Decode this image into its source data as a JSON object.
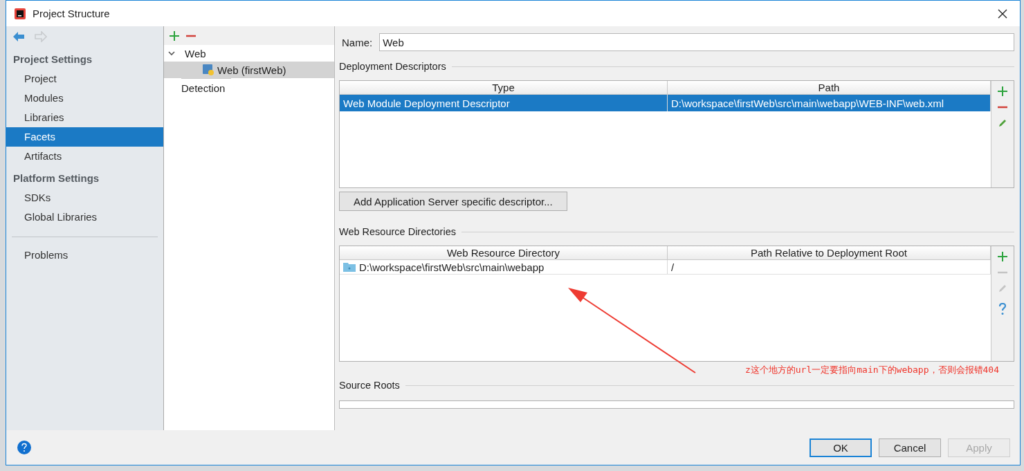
{
  "window": {
    "title": "Project Structure"
  },
  "sidebar": {
    "groups": [
      {
        "header": "Project Settings",
        "items": [
          {
            "label": "Project",
            "selected": false
          },
          {
            "label": "Modules",
            "selected": false
          },
          {
            "label": "Libraries",
            "selected": false
          },
          {
            "label": "Facets",
            "selected": true
          },
          {
            "label": "Artifacts",
            "selected": false
          }
        ]
      },
      {
        "header": "Platform Settings",
        "items": [
          {
            "label": "SDKs",
            "selected": false
          },
          {
            "label": "Global Libraries",
            "selected": false
          }
        ]
      }
    ],
    "footer_items": [
      {
        "label": "Problems",
        "selected": false
      }
    ]
  },
  "tree": {
    "nodes": [
      {
        "label": "Web",
        "expanded": true,
        "selected": false,
        "children": [
          {
            "label": "Web (firstWeb)",
            "selected": true
          }
        ]
      }
    ],
    "detection": "Detection"
  },
  "name_field": {
    "label": "Name:",
    "value": "Web"
  },
  "deployment_descriptors": {
    "title": "Deployment Descriptors",
    "columns": [
      "Type",
      "Path"
    ],
    "rows": [
      {
        "cells": [
          "Web Module Deployment Descriptor",
          "D:\\workspace\\firstWeb\\src\\main\\webapp\\WEB-INF\\web.xml"
        ],
        "selected": true
      }
    ],
    "tools": [
      {
        "kind": "add",
        "disabled": false
      },
      {
        "kind": "remove",
        "disabled": false
      },
      {
        "kind": "edit",
        "disabled": false
      }
    ],
    "button": "Add Application Server specific descriptor..."
  },
  "web_resource_directories": {
    "title": "Web Resource Directories",
    "columns": [
      "Web Resource Directory",
      "Path Relative to Deployment Root"
    ],
    "rows": [
      {
        "cells": [
          "D:\\workspace\\firstWeb\\src\\main\\webapp",
          "/"
        ],
        "selected": false
      }
    ],
    "tools": [
      {
        "kind": "add",
        "disabled": false
      },
      {
        "kind": "remove",
        "disabled": true
      },
      {
        "kind": "edit",
        "disabled": true
      },
      {
        "kind": "help",
        "disabled": false
      }
    ]
  },
  "annotation": {
    "text": "z这个地方的url一定要指向main下的webapp，否则会报错404"
  },
  "source_roots": {
    "title": "Source Roots"
  },
  "buttons": [
    {
      "label": "OK",
      "kind": "default",
      "disabled": false
    },
    {
      "label": "Cancel",
      "kind": "normal",
      "disabled": false
    },
    {
      "label": "Apply",
      "kind": "normal",
      "disabled": true
    }
  ]
}
